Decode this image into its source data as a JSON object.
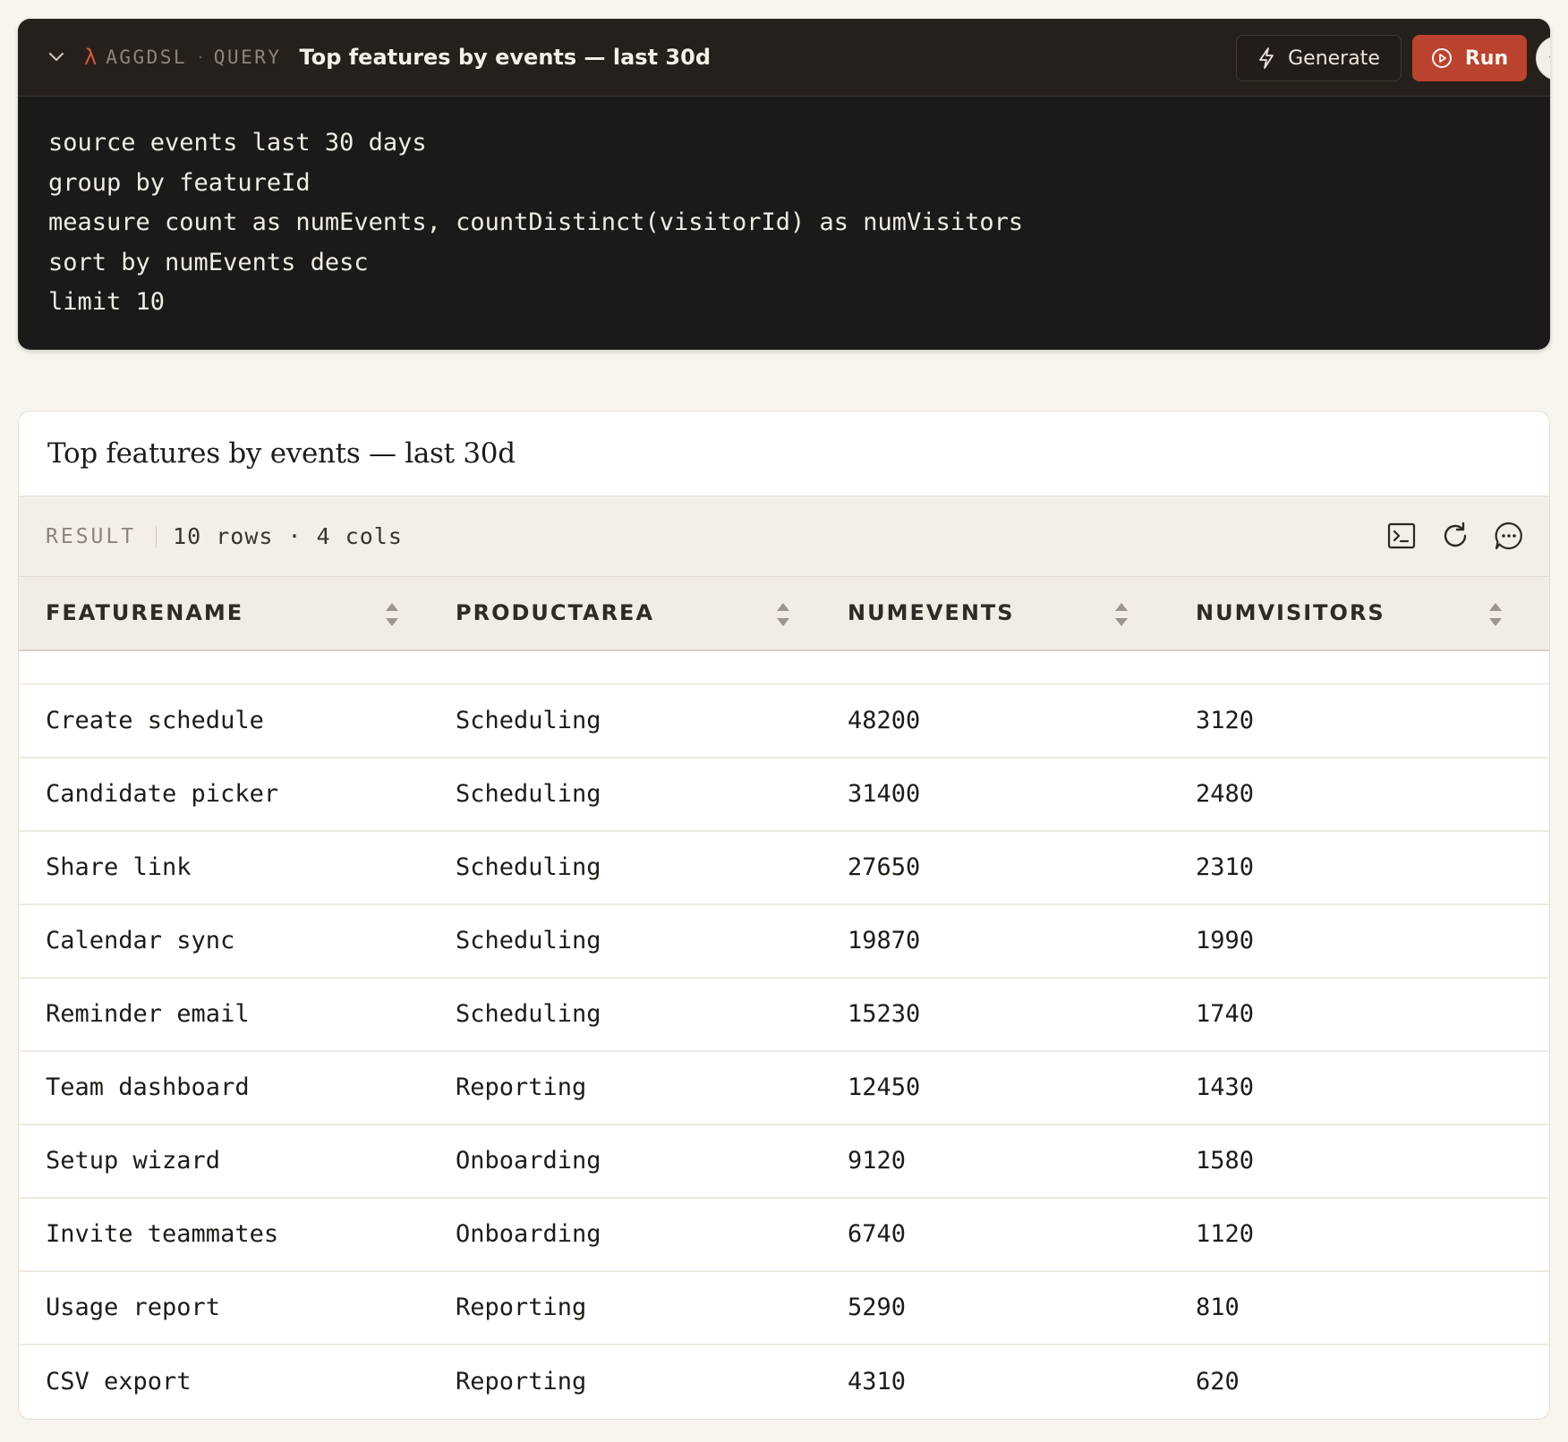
{
  "query": {
    "kicker_lang": "AGGDSL",
    "kicker_sep": "·",
    "kicker_kind": "QUERY",
    "title": "Top features by events — last 30d",
    "generate_label": "Generate",
    "run_label": "Run",
    "more_glyph": "▾",
    "code_lines": [
      "source events last 30 days",
      "group by featureId",
      "measure count as numEvents, countDistinct(visitorId) as numVisitors",
      "sort by numEvents desc",
      "limit 10"
    ],
    "accent_color": "#b9432f"
  },
  "result": {
    "title": "Top features by events — last 30d",
    "label": "RESULT",
    "meta": "10 rows · 4 cols",
    "columns": [
      "FEATURENAME",
      "PRODUCTAREA",
      "NUMEVENTS",
      "NUMVISITORS"
    ],
    "rows": [
      [
        "Create schedule",
        "Scheduling",
        "48200",
        "3120"
      ],
      [
        "Candidate picker",
        "Scheduling",
        "31400",
        "2480"
      ],
      [
        "Share link",
        "Scheduling",
        "27650",
        "2310"
      ],
      [
        "Calendar sync",
        "Scheduling",
        "19870",
        "1990"
      ],
      [
        "Reminder email",
        "Scheduling",
        "15230",
        "1740"
      ],
      [
        "Team dashboard",
        "Reporting",
        "12450",
        "1430"
      ],
      [
        "Setup wizard",
        "Onboarding",
        "9120",
        "1580"
      ],
      [
        "Invite teammates",
        "Onboarding",
        "6740",
        "1120"
      ],
      [
        "Usage report",
        "Reporting",
        "5290",
        "810"
      ],
      [
        "CSV export",
        "Reporting",
        "4310",
        "620"
      ]
    ]
  }
}
